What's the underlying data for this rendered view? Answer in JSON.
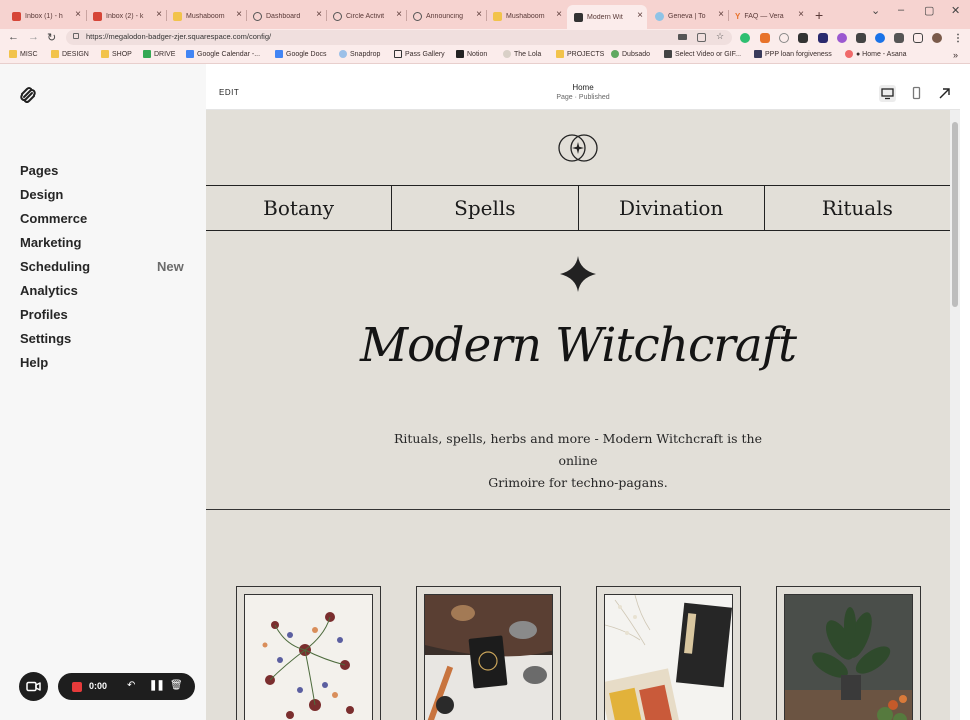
{
  "browser": {
    "tabs": [
      {
        "label": "Inbox (1) - h",
        "favicon": "gmail-icon",
        "active": false
      },
      {
        "label": "Inbox (2) - k",
        "favicon": "gmail-icon",
        "active": false
      },
      {
        "label": "Mushaboom",
        "favicon": "folder-icon",
        "active": false
      },
      {
        "label": "Dashboard",
        "favicon": "circle-icon",
        "active": false
      },
      {
        "label": "Circle Activit",
        "favicon": "circle-icon",
        "active": false
      },
      {
        "label": "Announcing",
        "favicon": "circle-icon",
        "active": false
      },
      {
        "label": "Mushaboom",
        "favicon": "folder-icon",
        "active": false
      },
      {
        "label": "Modern Wit",
        "favicon": "squarespace-icon",
        "active": true
      },
      {
        "label": "Geneva | To",
        "favicon": "geneva-icon",
        "active": false
      },
      {
        "label": "FAQ — Vera",
        "favicon": "ycombinator-icon",
        "active": false
      }
    ],
    "url": "https://megalodon-badger-zjer.squarespace.com/config/",
    "bookmarks": [
      {
        "label": "MISC",
        "icon": "folder-icon"
      },
      {
        "label": "DESIGN",
        "icon": "folder-icon"
      },
      {
        "label": "SHOP",
        "icon": "folder-icon"
      },
      {
        "label": "DRIVE",
        "icon": "drive-icon"
      },
      {
        "label": "Google Calendar -...",
        "icon": "calendar-icon"
      },
      {
        "label": "Google Docs",
        "icon": "docs-icon"
      },
      {
        "label": "Snapdrop",
        "icon": "snapdrop-icon"
      },
      {
        "label": "Pass Gallery",
        "icon": "pass-icon"
      },
      {
        "label": "Notion",
        "icon": "notion-icon"
      },
      {
        "label": "The Lola",
        "icon": "lola-icon"
      },
      {
        "label": "PROJECTS",
        "icon": "folder-icon"
      },
      {
        "label": "Dubsado",
        "icon": "dubsado-icon"
      },
      {
        "label": "Select Video or GIF...",
        "icon": "video-icon"
      },
      {
        "label": "PPP loan forgiveness",
        "icon": "ppp-icon"
      },
      {
        "label": "● Home - Asana",
        "icon": "asana-icon"
      }
    ],
    "more_bookmarks": "»"
  },
  "sidebar": {
    "items": [
      {
        "label": "Pages"
      },
      {
        "label": "Design"
      },
      {
        "label": "Commerce"
      },
      {
        "label": "Marketing"
      },
      {
        "label": "Scheduling",
        "badge": "New"
      },
      {
        "label": "Analytics"
      },
      {
        "label": "Profiles"
      },
      {
        "label": "Settings"
      },
      {
        "label": "Help"
      }
    ]
  },
  "recorder": {
    "time": "0:00"
  },
  "editor": {
    "edit_label": "EDIT",
    "page_title": "Home",
    "page_status": "Page · Published"
  },
  "site": {
    "nav": [
      "Botany",
      "Spells",
      "Divination",
      "Rituals"
    ],
    "hero_title": "Modern Witchcraft",
    "hero_line1": "Rituals, spells, herbs and more - Modern Witchcraft is the online",
    "hero_line2": "Grimoire for techno-pagans."
  },
  "colors": {
    "tab_strip": "#f6d3d0",
    "site_background": "#e2dfd8",
    "sidebar_background": "#f7f7f7",
    "recorder_red": "#e63b3b"
  }
}
